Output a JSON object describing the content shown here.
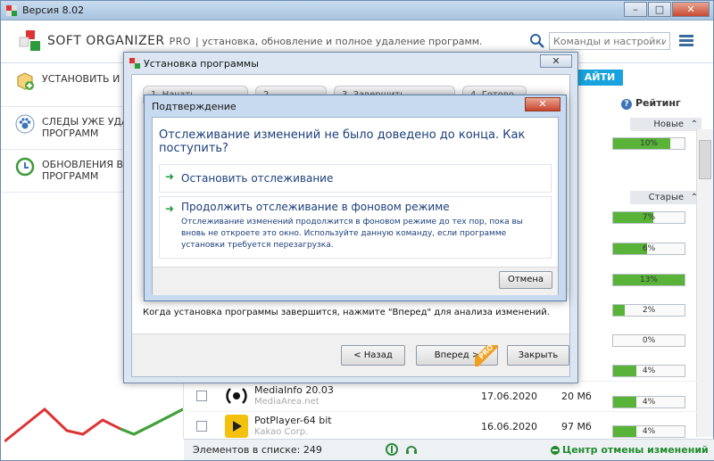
{
  "window": {
    "title": "Версия 8.02",
    "min_label": "–",
    "max_label": "□",
    "close_label": "✕"
  },
  "header": {
    "brand": "SOFT ORGANIZER",
    "pro": "PRO",
    "tagline": "| установка, обновление и полное удаление программ.",
    "search_placeholder": "Команды и настройки"
  },
  "sidebar": {
    "items": [
      {
        "label": "УСТАНОВИТЬ И ОТ"
      },
      {
        "label": "СЛЕДЫ УЖЕ УДАЛЕН ПРОГРАММ"
      },
      {
        "label": "ОБНОВЛЕНИЯ ВАШ ПРОГРАММ"
      }
    ]
  },
  "right": {
    "find_label": "АЙТИ",
    "rating_header": "Рейтинг",
    "group_new": "Новые",
    "group_old": "Старые",
    "ratings": [
      {
        "label": "10%",
        "value": 0.1
      },
      {
        "label": "7%",
        "value": 0.07
      },
      {
        "label": "6%",
        "value": 0.06
      },
      {
        "label": "13%",
        "value": 0.13
      },
      {
        "label": "2%",
        "value": 0.02
      },
      {
        "label": "0%",
        "value": 0.0
      },
      {
        "label": "4%",
        "value": 0.04
      },
      {
        "label": "4%",
        "value": 0.04
      },
      {
        "label": "4%",
        "value": 0.04
      }
    ]
  },
  "rows": [
    {
      "name": "MediaInfo 20.03",
      "publisher": "MediaArea.net",
      "date": "17.06.2020",
      "size": "20 Мб"
    },
    {
      "name": "PotPlayer-64 bit",
      "publisher": "Kakao Corp.",
      "date": "16.06.2020",
      "size": "97 Мб"
    }
  ],
  "status": {
    "count": "Элементов в списке: 249",
    "undo": "Центр отмены изменений"
  },
  "install_dialog": {
    "title": "Установка программы",
    "tabs": [
      "1. Начать слежение",
      "2. Установка",
      "3. Завершить слежение",
      "4. Готово"
    ],
    "status_text": "Когда установка программы завершится, нажмите \"Вперед\" для анализа изменений.",
    "back_label": "< Назад",
    "next_label": "Вперед >",
    "close_label": "Закрыть",
    "pro_badge": "PRO"
  },
  "confirm_dialog": {
    "title": "Подтверждение",
    "question": "Отслеживание изменений не было доведено до конца. Как поступить?",
    "option1": "Остановить отслеживание",
    "option2": "Продолжить отслеживание в фоновом режиме",
    "option2_desc": "Отслеживание изменений продолжится в фоновом режиме до тех пор, пока вы вновь не откроете это окно. Используйте данную команду, если программе установки требуется перезагрузка.",
    "cancel_label": "Отмена"
  },
  "colors": {
    "accent": "#18a3de",
    "green": "#58b338",
    "link": "#1b3f7a"
  }
}
